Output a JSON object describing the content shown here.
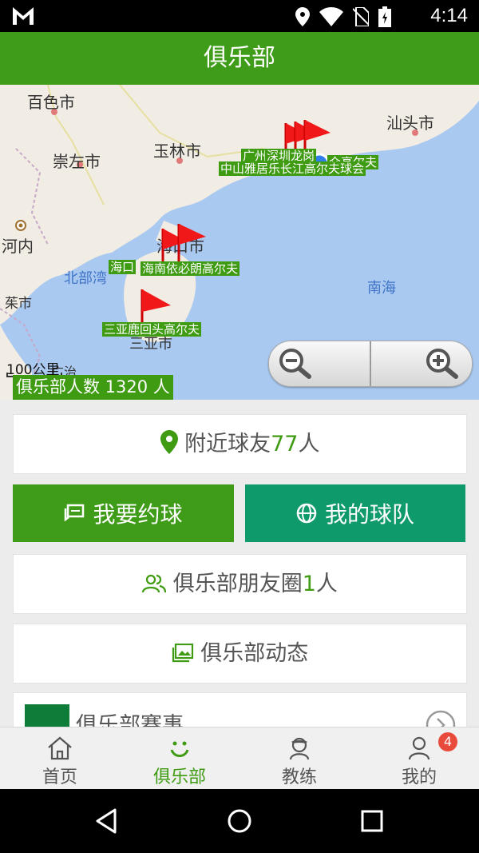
{
  "status_bar": {
    "time": "4:14"
  },
  "header": {
    "title": "俱乐部"
  },
  "map": {
    "places": [
      "百色市",
      "崇左市",
      "玉林市",
      "汕头市",
      "河内",
      "海口市",
      "茱市",
      "三亚市",
      "广治"
    ],
    "seas": [
      "北部湾",
      "南海"
    ],
    "clubs": [
      "广州",
      "深圳龙岗",
      "众高尔夫",
      "中山雅居乐长江高尔夫球会",
      "海口",
      "海南依必朗高尔夫",
      "三亚鹿回头高尔夫"
    ],
    "scale": "100公里",
    "member_count_label": "俱乐部人数  1320  人"
  },
  "cards": {
    "nearby_prefix": "附近球友",
    "nearby_count": "77",
    "nearby_suffix": "人",
    "friends_prefix": "俱乐部朋友圈",
    "friends_count": "1",
    "friends_suffix": "人",
    "news": "俱乐部动态",
    "events": "俱乐部赛事"
  },
  "buttons": {
    "book": "我要约球",
    "team": "我的球队"
  },
  "tabs": [
    {
      "label": "首页"
    },
    {
      "label": "俱乐部"
    },
    {
      "label": "教练"
    },
    {
      "label": "我的"
    }
  ],
  "badge": "4",
  "colors": {
    "brand_green": "#3f9c19",
    "team_green": "#0e9a6b",
    "badge_red": "#e84b3c"
  }
}
